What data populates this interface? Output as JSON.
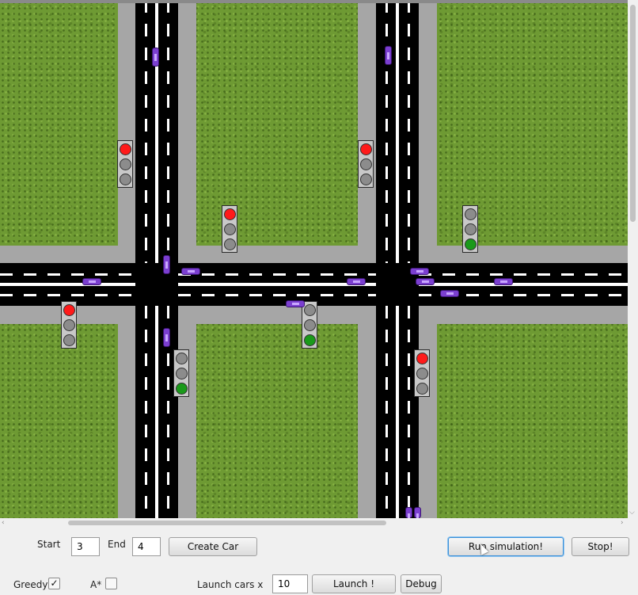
{
  "controls": {
    "start_label": "Start",
    "start_value": "3",
    "end_label": "End",
    "end_value": "4",
    "create_car_label": "Create Car",
    "run_simulation_label": "Run simulation!",
    "stop_label": "Stop!",
    "greedy_label": "Greedy",
    "greedy_checked": true,
    "astar_label": "A*",
    "astar_checked": false,
    "launch_cars_label": "Launch cars x",
    "launch_count_value": "10",
    "launch_label": "Launch !",
    "debug_label": "Debug"
  },
  "simulation": {
    "traffic_lights": [
      {
        "id": "tl-1",
        "state": "red"
      },
      {
        "id": "tl-2",
        "state": "red"
      },
      {
        "id": "tl-3",
        "state": "red"
      },
      {
        "id": "tl-4",
        "state": "green"
      },
      {
        "id": "tl-5",
        "state": "red"
      },
      {
        "id": "tl-6",
        "state": "green"
      },
      {
        "id": "tl-7",
        "state": "green"
      },
      {
        "id": "tl-8",
        "state": "red"
      }
    ],
    "colors": {
      "grass": "#6e9a33",
      "sidewalk": "#a6a6a6",
      "road": "#000000",
      "car": "#7b3fd0",
      "light_red": "#ff1a1a",
      "light_green": "#1a9a1a"
    }
  },
  "checkmark_glyph": "✓"
}
